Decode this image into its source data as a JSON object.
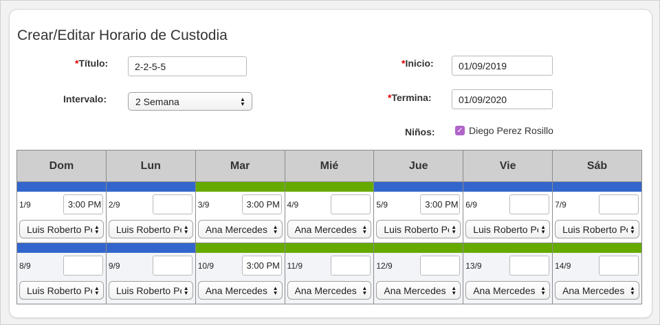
{
  "page": {
    "title": "Crear/Editar Horario de Custodia"
  },
  "form": {
    "title_label": "Título:",
    "title_value": "2-2-5-5",
    "interval_label": "Intervalo:",
    "interval_value": "2 Semana",
    "start_label": "Inicio:",
    "start_value": "01/09/2019",
    "end_label": "Termina:",
    "end_value": "01/09/2020",
    "children_label": "Niños:",
    "child_name": "Diego Perez Rosillo",
    "required_mark": "*"
  },
  "calendar": {
    "days": [
      "Dom",
      "Lun",
      "Mar",
      "Mié",
      "Jue",
      "Vie",
      "Sáb"
    ],
    "colors": {
      "blue": "#3366cc",
      "green": "#66aa00"
    },
    "weeks": [
      [
        {
          "date": "1/9",
          "time": "3:00 PM",
          "parent": "Luis Roberto Perez",
          "color": "blue"
        },
        {
          "date": "2/9",
          "time": "",
          "parent": "Luis Roberto Perez",
          "color": "blue"
        },
        {
          "date": "3/9",
          "time": "3:00 PM",
          "parent": "Ana Mercedes Rosillo",
          "color": "green"
        },
        {
          "date": "4/9",
          "time": "",
          "parent": "Ana Mercedes Rosillo",
          "color": "green"
        },
        {
          "date": "5/9",
          "time": "3:00 PM",
          "parent": "Luis Roberto Perez",
          "color": "blue"
        },
        {
          "date": "6/9",
          "time": "",
          "parent": "Luis Roberto Perez",
          "color": "blue"
        },
        {
          "date": "7/9",
          "time": "",
          "parent": "Luis Roberto Perez",
          "color": "blue"
        }
      ],
      [
        {
          "date": "8/9",
          "time": "",
          "parent": "Luis Roberto Perez",
          "color": "blue"
        },
        {
          "date": "9/9",
          "time": "",
          "parent": "Luis Roberto Perez",
          "color": "blue"
        },
        {
          "date": "10/9",
          "time": "3:00 PM",
          "parent": "Ana Mercedes Rosillo",
          "color": "green"
        },
        {
          "date": "11/9",
          "time": "",
          "parent": "Ana Mercedes Rosillo",
          "color": "green"
        },
        {
          "date": "12/9",
          "time": "",
          "parent": "Ana Mercedes Rosillo",
          "color": "green"
        },
        {
          "date": "13/9",
          "time": "",
          "parent": "Ana Mercedes Rosillo",
          "color": "green"
        },
        {
          "date": "14/9",
          "time": "",
          "parent": "Ana Mercedes Rosillo",
          "color": "green"
        }
      ]
    ]
  }
}
